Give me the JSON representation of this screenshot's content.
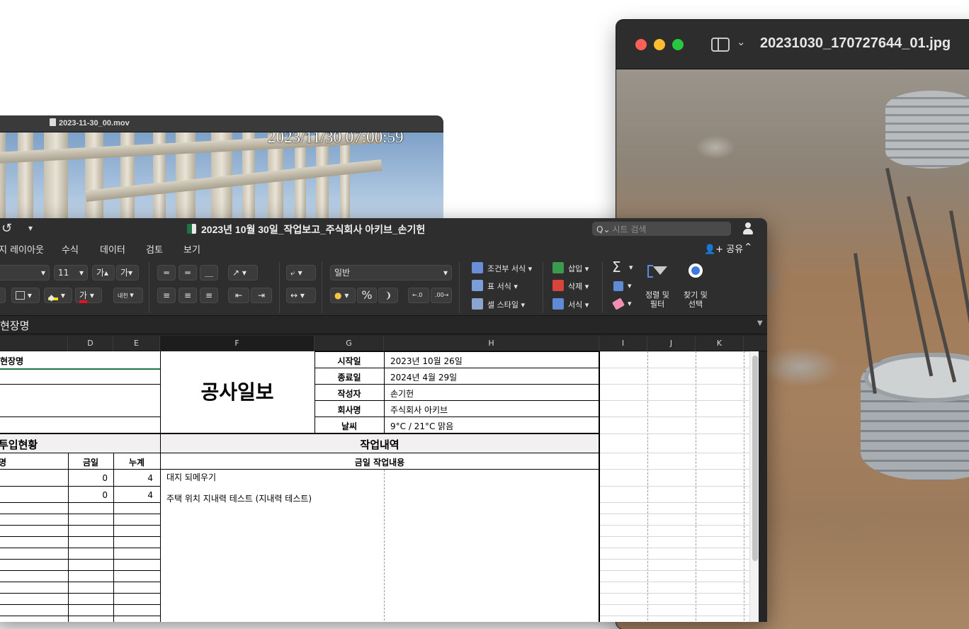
{
  "photo_window": {
    "title": "20231030_170727644_01.jpg",
    "toolbar_chevron": "⌄"
  },
  "video_window": {
    "title": "2023-11-30_00.mov",
    "timestamp": "2023/11/30 07:00:59"
  },
  "excel": {
    "title": "2023년 10월 30일_작업보고_주식회사 아키브_손기헌",
    "undo_glyph": "↺",
    "qat_glyph": "▾",
    "search_placeholder": "시트 검색",
    "search_icon": "Q⌄",
    "menu": [
      "지 레이아웃",
      "수식",
      "데이터",
      "검토",
      "보기"
    ],
    "share_label": "공유",
    "collapse_glyph": "⌃",
    "ribbon": {
      "font_size": "11",
      "grow_font": "가▴",
      "shrink_font": "가▾",
      "number_format": "일반",
      "percent": "%",
      "comma": "❩",
      "conditional_format": "조건부 서식",
      "table_format": "표 서식",
      "cell_style": "셀 스타일",
      "insert": "삽입",
      "delete": "삭제",
      "format": "서식",
      "sort_filter_1": "정렬 및",
      "sort_filter_2": "필터",
      "find_select_1": "찾기 및",
      "find_select_2": "선택",
      "sigma": "Σ",
      "font_color_glyph": "가",
      "phonetic_glyph": "내천",
      "dropdown": "▾"
    },
    "formula_bar": "현장명",
    "formula_bar_dropdown": "▼",
    "columns": [
      "D",
      "E",
      "F",
      "G",
      "H",
      "I",
      "J",
      "K"
    ],
    "sheet": {
      "site_name_label": "현장명",
      "report_title": "공사일보",
      "info_labels": [
        "시작일",
        "종료일",
        "작성자",
        "회사명",
        "날씨"
      ],
      "info_values": [
        "2023년 10월 26일",
        "2024년 4월 29일",
        "손기헌",
        "주식회사 아키브",
        "9°C / 21°C 맑음"
      ],
      "section_left": "투입현황",
      "section_right": "작업내역",
      "left_header_partial": "명",
      "col_today": "금일",
      "col_cumulative": "누계",
      "col_today_work": "금일 작업내용",
      "rows": [
        {
          "today": "0",
          "cumulative": "4"
        },
        {
          "today": "0",
          "cumulative": "4"
        }
      ],
      "work_items": [
        "대지 되메우기",
        "주택 위치 지내력 테스트 (지내력 테스트)"
      ]
    }
  }
}
